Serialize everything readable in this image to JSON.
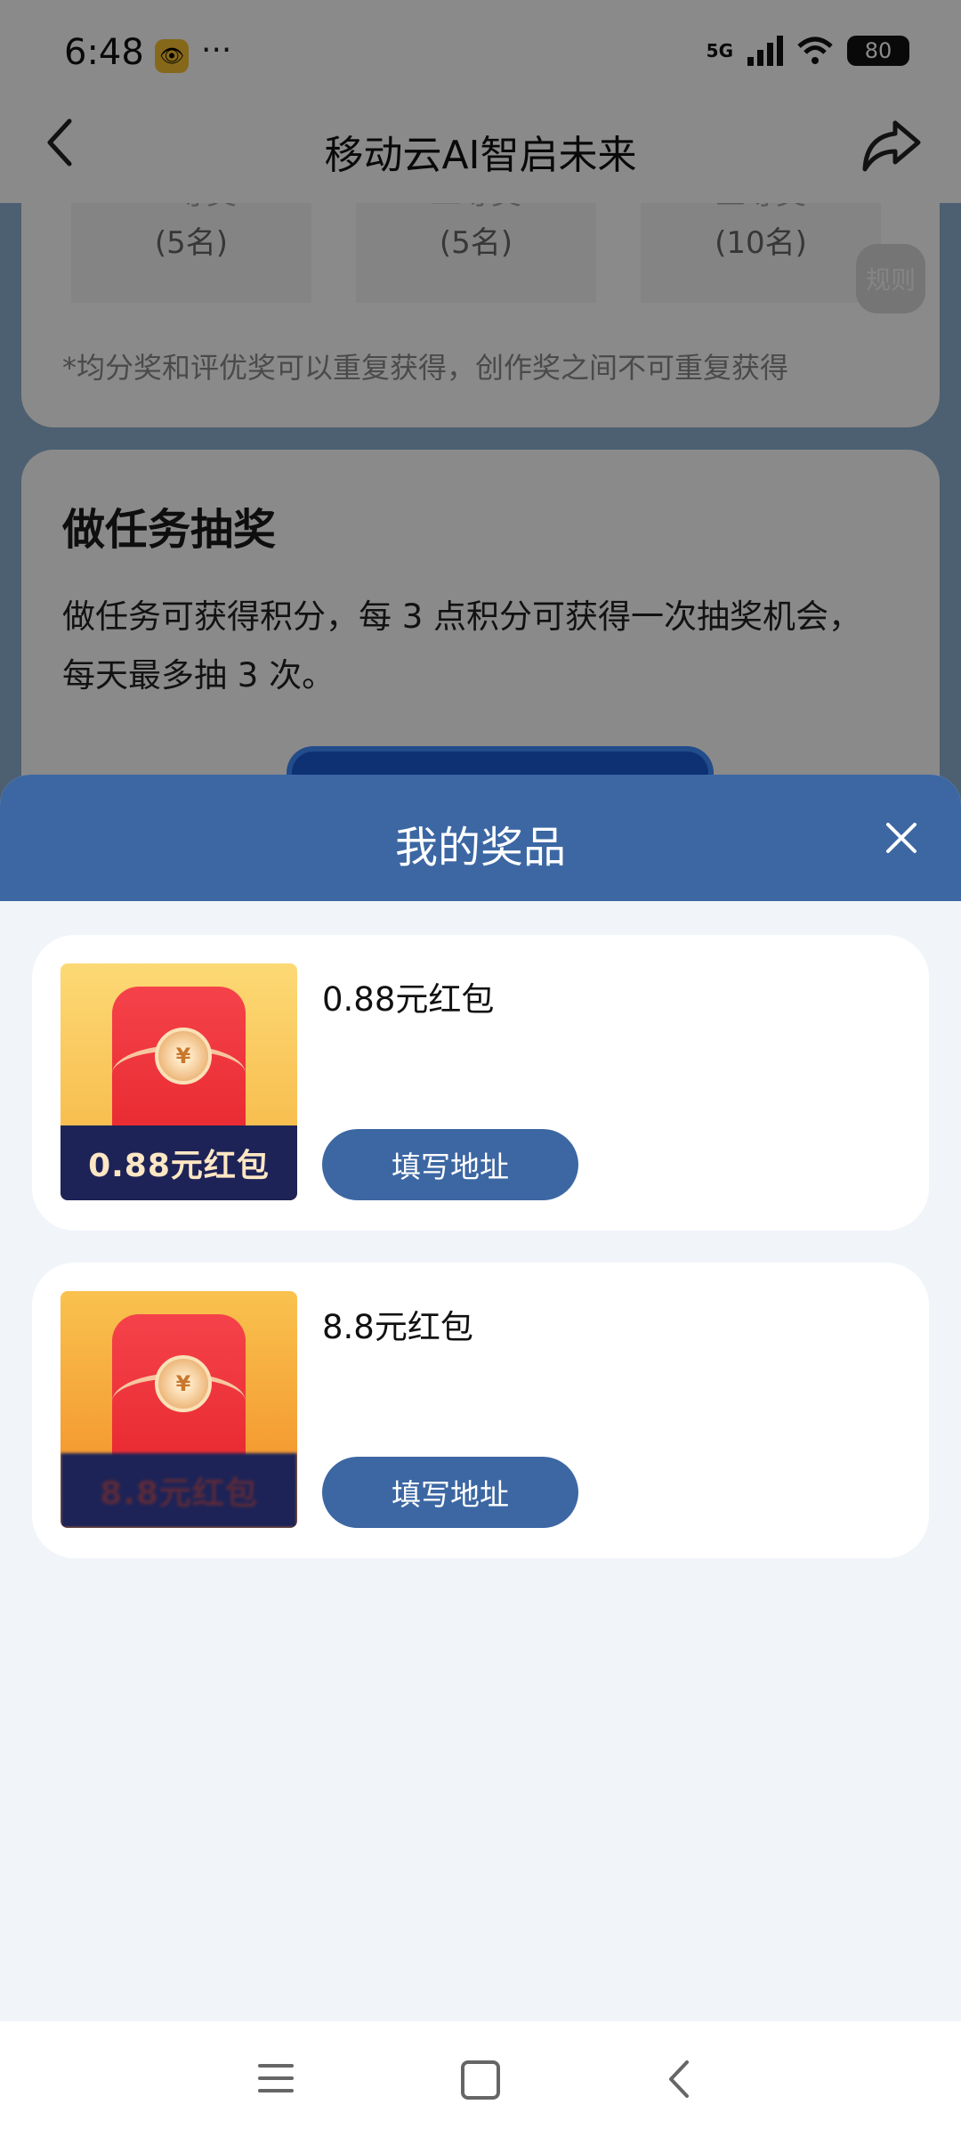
{
  "status_bar": {
    "time": "6:48",
    "more": "···",
    "network": "5G",
    "battery": "80"
  },
  "header": {
    "title": "移动云AI智启未来"
  },
  "background": {
    "prize_levels": [
      {
        "rank": "一等奖",
        "count": "(5名)"
      },
      {
        "rank": "二等奖",
        "count": "(5名)"
      },
      {
        "rank": "三等奖",
        "count": "(10名)"
      }
    ],
    "note": "*均分奖和评优奖可以重复获得，创作奖之间不可重复获得",
    "rules_label": "规则",
    "task_title": "做任务抽奖",
    "task_desc": "做任务可获得积分，每 3 点积分可获得一次抽奖机会，每天最多抽 3 次。"
  },
  "sheet": {
    "title": "我的奖品",
    "prizes": [
      {
        "name": "0.88元红包",
        "thumb_label": "0.88元红包",
        "button": "填写地址"
      },
      {
        "name": "8.8元红包",
        "thumb_label": "8.8元红包",
        "button": "填写地址"
      }
    ]
  },
  "colors": {
    "accent": "#3c67a3",
    "envelope": "#e7272e"
  }
}
